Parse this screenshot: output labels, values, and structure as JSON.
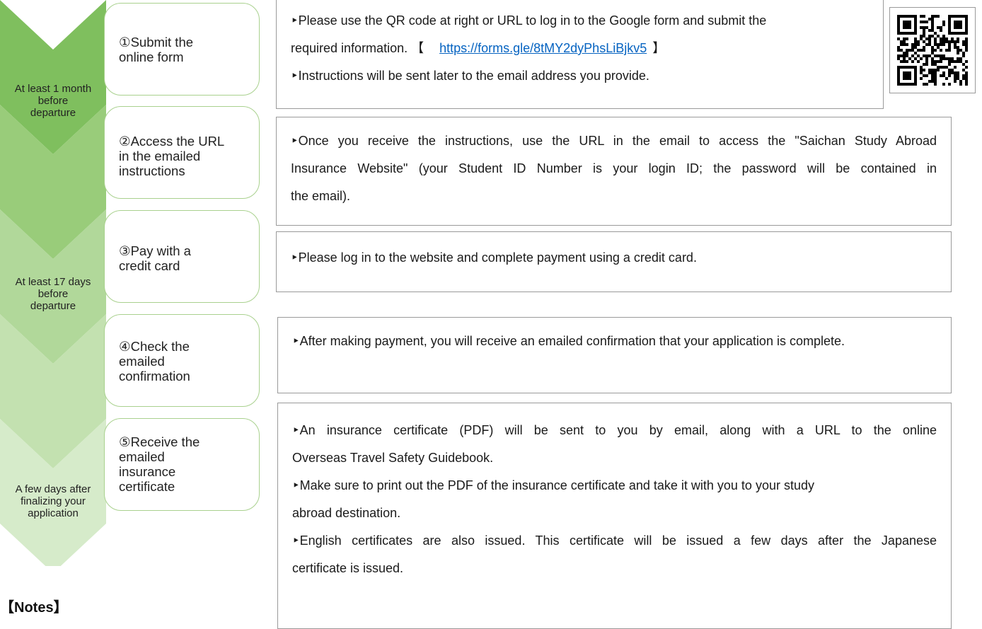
{
  "timing": {
    "t1": [
      "At least 1 month",
      "before",
      "departure"
    ],
    "t3": [
      "At least 17 days",
      "before",
      "departure"
    ],
    "t5": [
      "A few days after",
      "finalizing your",
      "application"
    ]
  },
  "steps": [
    {
      "lines": [
        "①Submit the",
        "online form"
      ]
    },
    {
      "lines": [
        "②Access the URL",
        "in the emailed",
        "instructions"
      ]
    },
    {
      "lines": [
        "③Pay with a",
        "credit card"
      ]
    },
    {
      "lines": [
        "④Check the",
        "emailed",
        "confirmation"
      ]
    },
    {
      "lines": [
        "⑤Receive the",
        "emailed",
        "insurance",
        "certificate"
      ]
    }
  ],
  "box1": {
    "line1": "‣Please use the QR code at right or URL to log in to the Google form and submit the",
    "line2_prefix": "required information.  【",
    "link": "https://forms.gle/8tMY2dyPhsLiBjkv5",
    "line2_suffix": "】",
    "line3": "‣Instructions will be sent later to the email address you provide."
  },
  "box2": {
    "line1": "‣Once you receive the instructions, use the URL in the email to access the \"Saichan Study Abroad",
    "line2": "Insurance Website\" (your Student ID Number is your login ID; the password will be contained in",
    "line3": "the email)."
  },
  "box3": {
    "line1": "‣Please log in to the website and complete payment using a credit card."
  },
  "box4": {
    "line1": "‣After making payment, you will receive an emailed confirmation that your application is complete."
  },
  "box5": {
    "line1": "‣An insurance certificate (PDF) will be sent to you by email, along with a URL to the online",
    "line2": "Overseas Travel Safety Guidebook.",
    "line3": "‣Make sure to print out the PDF of the insurance certificate and take it with you to your study",
    "line4": "abroad destination.",
    "line5": "‣English certificates are also issued. This certificate will be issued a few days after the Japanese",
    "line6": "certificate is issued."
  },
  "notes": {
    "label": "【Notes】"
  },
  "colors": {
    "chevron": [
      "#7fbf5e",
      "#99cc7a",
      "#b1d89a",
      "#c3e1b0",
      "#d6ebca"
    ],
    "step_border": "#a9d18e",
    "link": "#0563c1",
    "box_border": "#9a9a9a"
  },
  "icons": {
    "qr": "qr-code-icon"
  }
}
